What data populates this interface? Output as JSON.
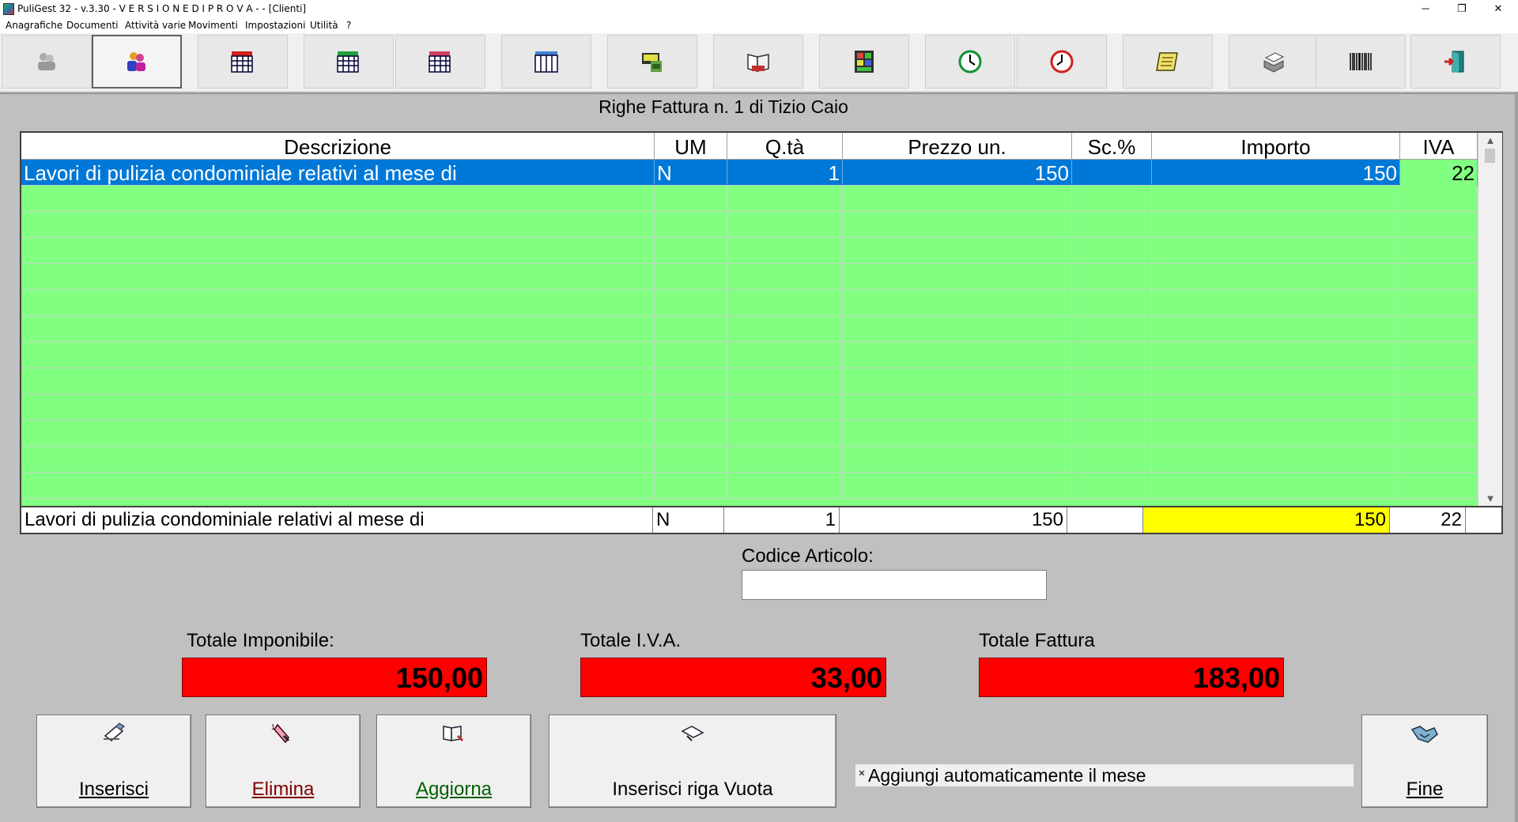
{
  "window": {
    "title": "PuliGest 32 - v.3.30 - V E R S I O N E  D I  P R O V A - - [Clienti]",
    "minimize": "─",
    "restore": "❐",
    "close": "✕"
  },
  "menu": [
    "Anagrafiche",
    "Documenti",
    "Attività varie",
    "Movimenti",
    "Impostazioni",
    "Utilità",
    "?"
  ],
  "toolbar": {
    "buttons": [
      {
        "icon": "users-gray-icon"
      },
      {
        "icon": "clients-icon"
      },
      {
        "icon": "ddt-calendar-icon"
      },
      {
        "icon": "invoice-calendar-icon"
      },
      {
        "icon": "quote-calendar-icon"
      },
      {
        "icon": "calendar-grid-icon"
      },
      {
        "icon": "office-icon"
      },
      {
        "icon": "books-icon"
      },
      {
        "icon": "numbers-icon"
      },
      {
        "icon": "clock-green-icon"
      },
      {
        "icon": "clock-red-icon"
      },
      {
        "icon": "notepad-icon"
      },
      {
        "icon": "printer-icon"
      },
      {
        "icon": "barcode-icon"
      },
      {
        "icon": "exit-door-icon"
      }
    ],
    "active_index": 1
  },
  "panel": {
    "title": "Righe Fattura n. 1 di Tizio Caio"
  },
  "grid": {
    "headers": [
      "Descrizione",
      "UM",
      "Q.tà",
      "Prezzo un.",
      "Sc.%",
      "Importo",
      "IVA"
    ],
    "rows": [
      {
        "descrizione": "Lavori di pulizia condominiale relativi al mese di",
        "um": "N",
        "qta": "1",
        "prezzo": "150",
        "sconto": "",
        "importo": "150",
        "iva": "22"
      }
    ],
    "empty_rows": 12,
    "edit_row": {
      "descrizione": "Lavori di pulizia condominiale relativi al mese di",
      "um": "N",
      "qta": "1",
      "prezzo": "150",
      "sconto": "",
      "importo": "150",
      "iva": "22"
    }
  },
  "codice_articolo": {
    "label": "Codice Articolo:",
    "value": ""
  },
  "totals": {
    "imponibile_label": "Totale Imponibile:",
    "imponibile": "150,00",
    "iva_label": "Totale I.V.A.",
    "iva": "33,00",
    "fattura_label": "Totale Fattura",
    "fattura": "183,00"
  },
  "buttons": {
    "inserisci": {
      "label": "Inserisci",
      "accent_color": "#000000"
    },
    "elimina": {
      "label": "Elimina",
      "accent_color": "#800000"
    },
    "aggiorna": {
      "label": "Aggiorna",
      "accent_color": "#006000"
    },
    "riga_vuota": {
      "label": "Inserisci riga Vuota",
      "accent_color": "#000000"
    },
    "fine": {
      "label": "Fine",
      "accent_color": "#000000"
    }
  },
  "checkbox": {
    "label": "Aggiungi automaticamente il mese",
    "checked": true,
    "mark": "✕"
  },
  "colors": {
    "grid_bg": "#80ff80",
    "selected": "#0078d7",
    "totals": "#ff0000",
    "highlight": "#ffff00"
  }
}
